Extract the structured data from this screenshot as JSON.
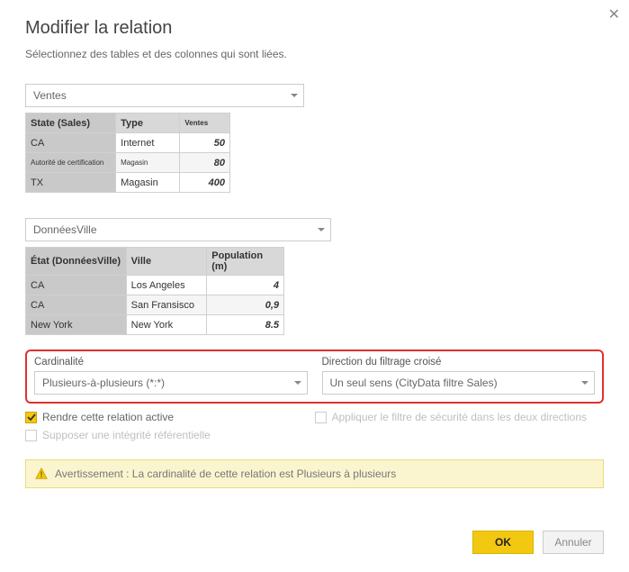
{
  "dialog": {
    "title": "Modifier la relation",
    "subtitle": "Sélectionnez des tables et des colonnes qui sont liées."
  },
  "tableA": {
    "selected": "Ventes",
    "headers": {
      "col0": "State (Sales)",
      "col1": "Type",
      "col2": "Ventes"
    },
    "rows": [
      {
        "c0": "CA",
        "c1": "Internet",
        "c2": "50"
      },
      {
        "c0": "Autorité de certification",
        "c1": "Magasin",
        "c2": "80"
      },
      {
        "c0": "TX",
        "c1": "Magasin",
        "c2": "400"
      }
    ]
  },
  "tableB": {
    "selected": "DonnéesVille",
    "headers": {
      "col0": "État (DonnéesVille)",
      "col1": "Ville",
      "col2": "Population (m)"
    },
    "rows": [
      {
        "c0": "CA",
        "c1": "Los Angeles",
        "c2": "4"
      },
      {
        "c0": "CA",
        "c1": "San Fransisco",
        "c2": "0,9"
      },
      {
        "c0": "New York",
        "c1": "New York",
        "c2": "8.5"
      }
    ]
  },
  "cardinality": {
    "label": "Cardinalité",
    "value": "Plusieurs-à-plusieurs (*:*)"
  },
  "crossFilter": {
    "label": "Direction du filtrage croisé",
    "value": "Un seul sens (CityData filtre Sales)"
  },
  "checks": {
    "active": "Rendre cette relation active",
    "integrity": "Supposer une intégrité référentielle",
    "security": "Appliquer le filtre de sécurité dans les deux directions"
  },
  "warning": {
    "text": "Avertissement : La cardinalité de cette relation est Plusieurs à plusieurs"
  },
  "buttons": {
    "ok": "OK",
    "cancel": "Annuler"
  }
}
